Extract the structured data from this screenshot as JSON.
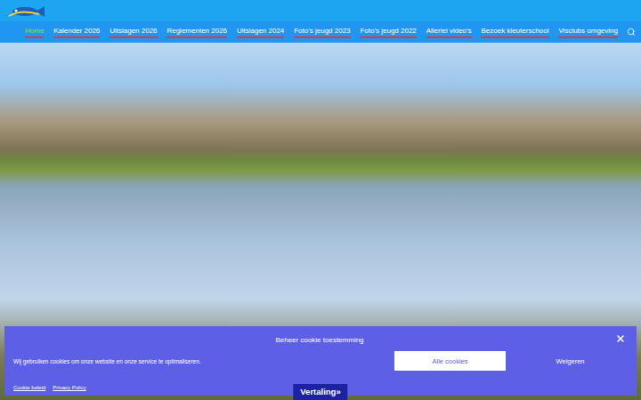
{
  "nav": {
    "items": [
      {
        "label": "Home",
        "selected": true
      },
      {
        "label": "Kalender 2026",
        "selected": false
      },
      {
        "label": "Uitslagen 2026",
        "selected": false
      },
      {
        "label": "Reglementen 2026",
        "selected": false
      },
      {
        "label": "Uitslagen 2024",
        "selected": false
      },
      {
        "label": "Foto's jeugd 2023",
        "selected": false
      },
      {
        "label": "Foto's jeugd 2022",
        "selected": false
      },
      {
        "label": "Allerlei video's",
        "selected": false
      },
      {
        "label": "Bezoek kleuterschool",
        "selected": false
      },
      {
        "label": "Visclubs omgeving",
        "selected": false
      }
    ]
  },
  "cookie_banner": {
    "title": "Beheer cookie toestemming",
    "message": "Wij gebruiken cookies om onze website en onze service te optimaliseren.",
    "buttons": [
      {
        "label": "Alle cookies",
        "kind": "filled"
      },
      {
        "label": "Weigeren",
        "kind": "text"
      }
    ],
    "links": [
      "Cookie beleid",
      "Privacy Policy"
    ]
  },
  "translate_button": {
    "label": "Vertaling»"
  }
}
